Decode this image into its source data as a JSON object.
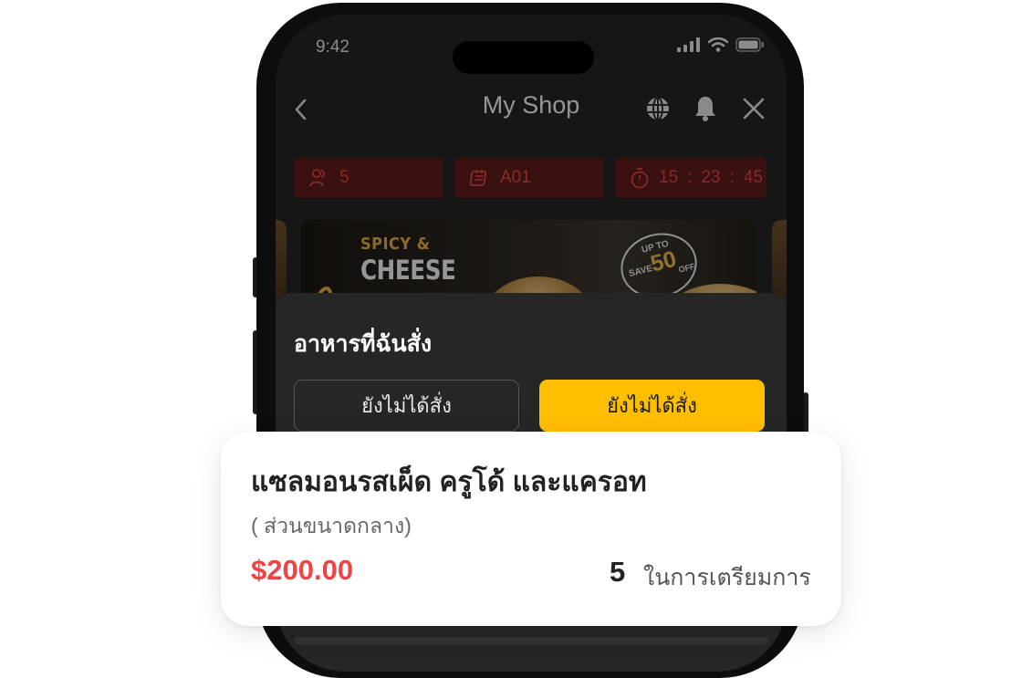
{
  "status_bar": {
    "time": "9:42"
  },
  "header": {
    "title": "My Shop",
    "back_icon": "chevron-left-icon",
    "icons": [
      "globe-icon",
      "bell-icon",
      "close-icon"
    ]
  },
  "info_bar": {
    "guests": "5",
    "table": "A01",
    "timer": {
      "hh": "15",
      "mm": "23",
      "ss": "45"
    }
  },
  "banner": {
    "line1": "SPICY &",
    "line2": "CHEESE",
    "badge_top": "UP TO",
    "badge_save": "SAVE",
    "badge_percent": "50",
    "badge_off": "OFF"
  },
  "sheet": {
    "title": "อาหารที่ฉันสั่ง",
    "tabs": [
      {
        "label": "ยังไม่ได้สั่ง",
        "active": false
      },
      {
        "label": "ยังไม่ได้สั่ง",
        "active": true
      }
    ]
  },
  "order_item": {
    "name": "แซลมอนรสเผ็ด ครูโด้ และแครอท",
    "size": "( ส่วนขนาดกลาง)",
    "price": "$200.00",
    "quantity": "5",
    "status": "ในการเตรียมการ"
  },
  "colors": {
    "accent": "#ffbe00",
    "price": "#ef4444",
    "chip_text": "#d14040",
    "chip_bg": "#5a1a1a"
  }
}
